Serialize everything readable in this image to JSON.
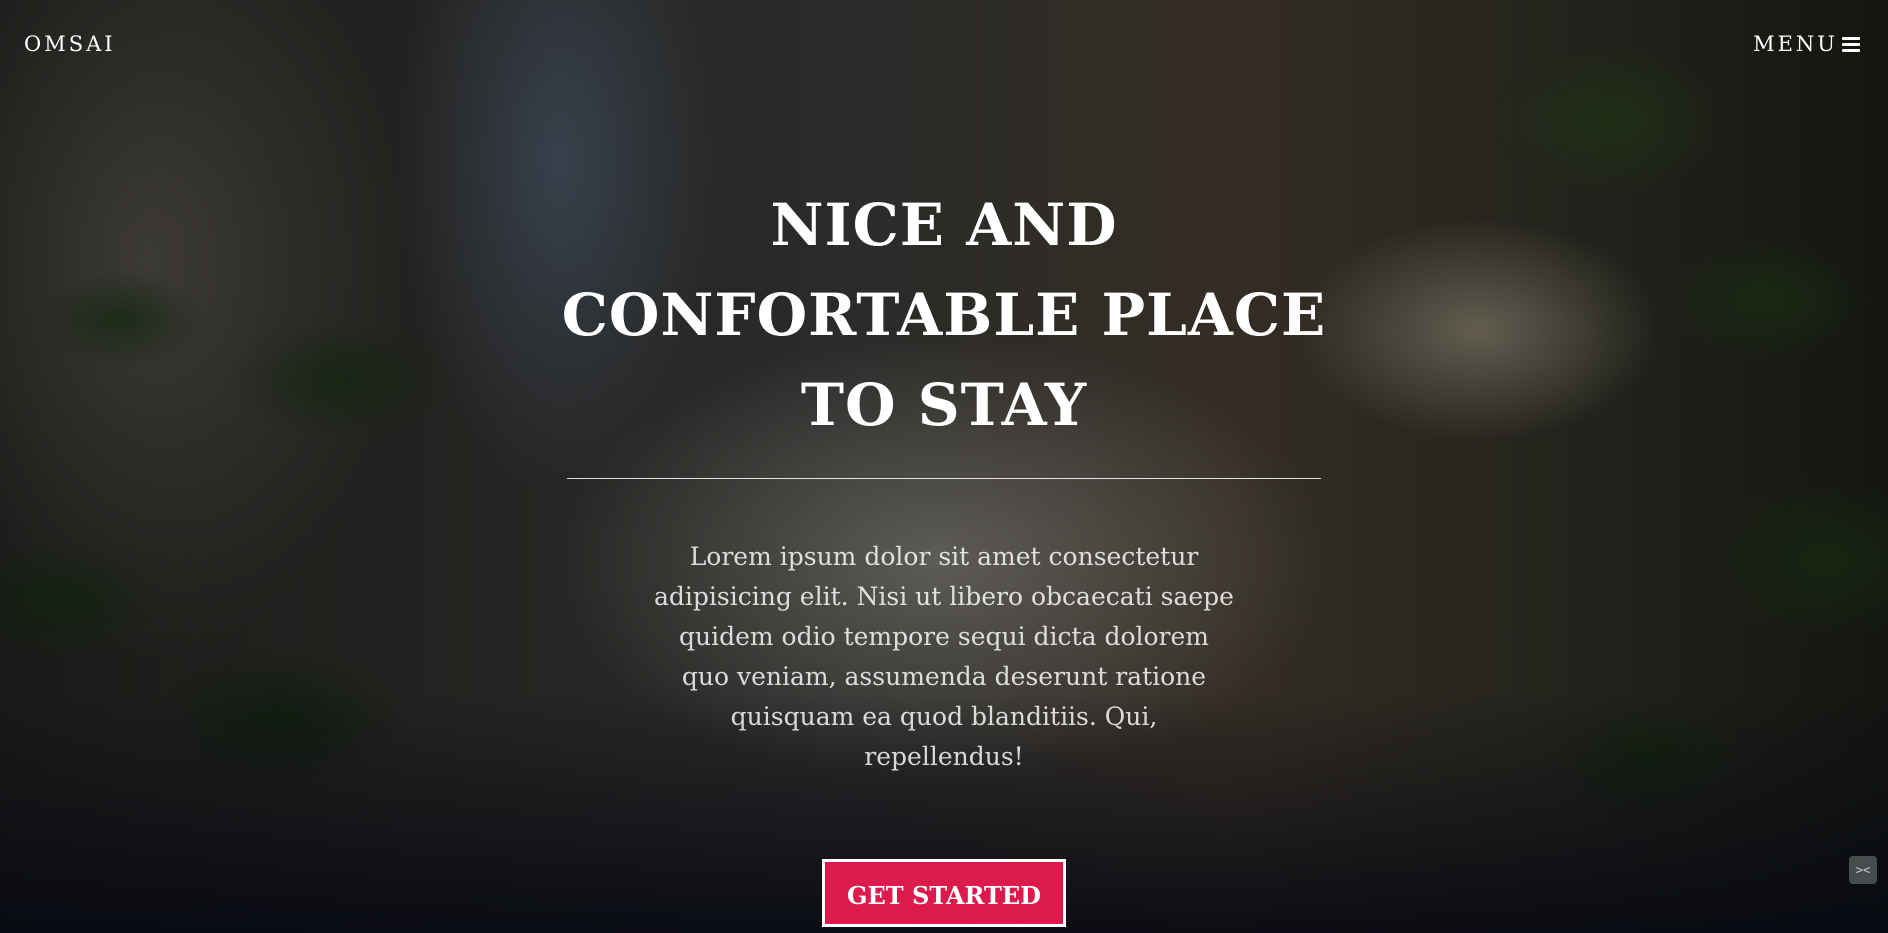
{
  "header": {
    "brand": "OMSAI",
    "menu_label": "MENU"
  },
  "hero": {
    "title": "NICE AND CONFORTABLE PLACE TO STAY",
    "description": "Lorem ipsum dolor sit amet consectetur adipisicing elit. Nisi ut libero obcaecati saepe quidem odio tempore sequi dicta dolorem quo veniam, assumenda deserunt ratione quisquam ea quod blanditiis. Qui, repellendus!",
    "cta_label": "GET STARTED"
  },
  "icons": {
    "menu": "hamburger-icon",
    "corner": "code-icon"
  },
  "colors": {
    "cta_background": "#dc1a4c",
    "text": "#ffffff"
  }
}
